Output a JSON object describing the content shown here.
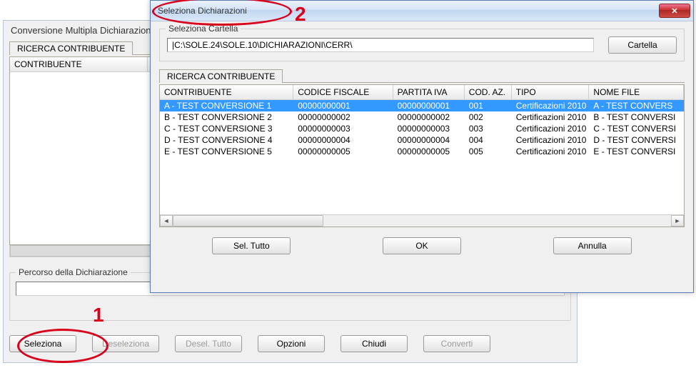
{
  "parent": {
    "title": "Conversione Multipla Dichiarazioni",
    "tab": "RICERCA CONTRIBUENTE",
    "grid_header": "CONTRIBUENTE",
    "percorso_group": "Percorso della Dichiarazione",
    "percorso_value": "",
    "buttons": {
      "seleziona": "Seleziona",
      "deseleziona": "Deseleziona",
      "desel_tutto": "Desel. Tutto",
      "opzioni": "Opzioni",
      "chiudi": "Chiudi",
      "converti": "Converti"
    }
  },
  "dialog": {
    "title": "Seleziona Dichiarazioni",
    "cartella_group": "Seleziona Cartella",
    "cartella_path": "|C:\\SOLE.24\\SOLE.10\\DICHIARAZIONI\\CERR\\",
    "cartella_button": "Cartella",
    "tab": "RICERCA CONTRIBUENTE",
    "columns": {
      "contribuente": "CONTRIBUENTE",
      "codice_fiscale": "CODICE FISCALE",
      "partita_iva": "PARTITA IVA",
      "cod_az": "COD. AZ.",
      "tipo": "TIPO",
      "nome_file": "NOME FILE"
    },
    "rows": [
      {
        "contribuente": "A - TEST CONVERSIONE 1",
        "cf": "00000000001",
        "piva": "00000000001",
        "caz": "001",
        "tipo": "Certificazioni 2010",
        "nome": "A - TEST CONVERS",
        "selected": true
      },
      {
        "contribuente": "B - TEST CONVERSIONE 2",
        "cf": "00000000002",
        "piva": "00000000002",
        "caz": "002",
        "tipo": "Certificazioni 2010",
        "nome": "B - TEST CONVERSI",
        "selected": false
      },
      {
        "contribuente": "C - TEST CONVERSIONE 3",
        "cf": "00000000003",
        "piva": "00000000003",
        "caz": "003",
        "tipo": "Certificazioni 2010",
        "nome": "C - TEST CONVERSI",
        "selected": false
      },
      {
        "contribuente": "D - TEST CONVERSIONE 4",
        "cf": "00000000004",
        "piva": "00000000004",
        "caz": "004",
        "tipo": "Certificazioni 2010",
        "nome": "D - TEST CONVERSI",
        "selected": false
      },
      {
        "contribuente": "E - TEST CONVERSIONE 5",
        "cf": "00000000005",
        "piva": "00000000005",
        "caz": "005",
        "tipo": "Certificazioni 2010",
        "nome": "E - TEST CONVERSI",
        "selected": false
      }
    ],
    "buttons": {
      "sel_tutto": "Sel. Tutto",
      "ok": "OK",
      "annulla": "Annulla"
    }
  },
  "annotations": {
    "one": "1",
    "two": "2"
  }
}
